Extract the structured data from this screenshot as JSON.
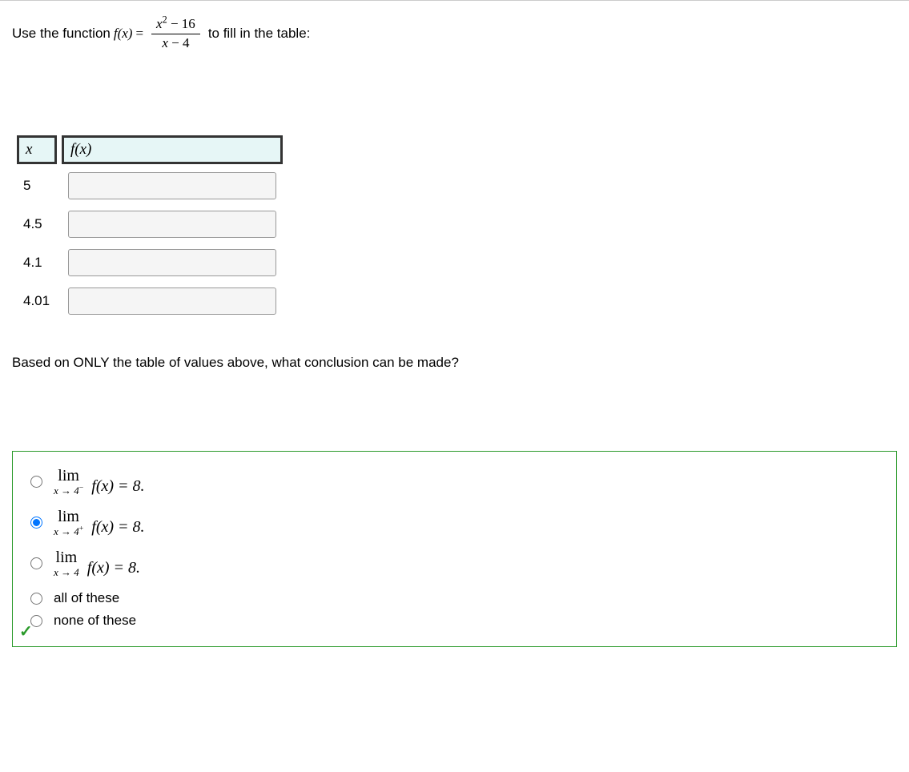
{
  "prompt": {
    "before": "Use the function ",
    "fx": "f(x)",
    "eq": " = ",
    "frac_num_a": "x",
    "frac_num_sup": "2",
    "frac_num_b": " − 16",
    "frac_den_a": "x",
    "frac_den_b": " − 4",
    "after": " to fill in the table:"
  },
  "table": {
    "h_x": "x",
    "h_fx": "f(x)",
    "rows": [
      {
        "x": "5",
        "fx": ""
      },
      {
        "x": "4.5",
        "fx": ""
      },
      {
        "x": "4.1",
        "fx": ""
      },
      {
        "x": "4.01",
        "fx": ""
      }
    ]
  },
  "conclusion_q": "Based on ONLY the table of values above, what conclusion can be made?",
  "options": {
    "o1": {
      "lim": "lim",
      "to": "x → 4",
      "sup": "−",
      "fxeq": "f(x) = 8.",
      "selected": false
    },
    "o2": {
      "lim": "lim",
      "to": "x → 4",
      "sup": "+",
      "fxeq": "f(x) = 8.",
      "selected": true
    },
    "o3": {
      "lim": "lim",
      "to": "x → 4",
      "sup": "",
      "fxeq": "f(x) = 8.",
      "selected": false
    },
    "o4": {
      "text": "all of these",
      "selected": false
    },
    "o5": {
      "text": "none of these",
      "selected": false
    }
  },
  "checkmark": "✓"
}
